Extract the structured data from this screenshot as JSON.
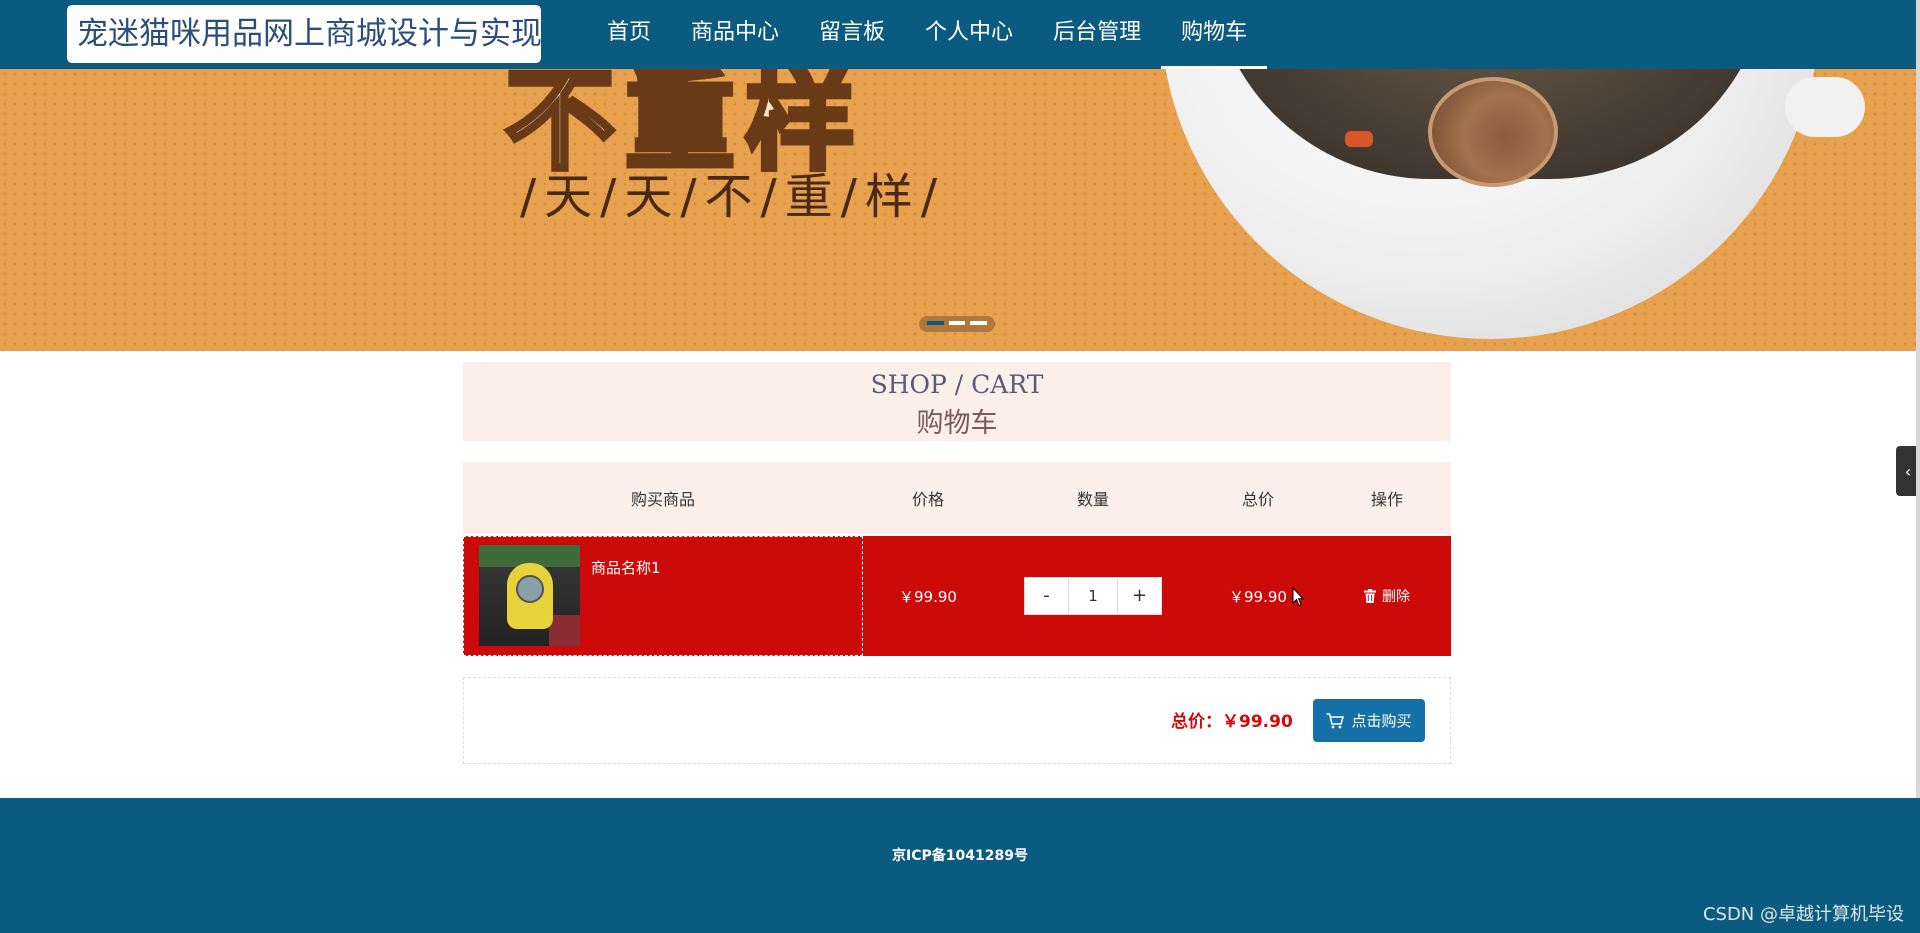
{
  "site": {
    "title": "宠迷猫咪用品网上商城设计与实现"
  },
  "nav": {
    "items": [
      {
        "label": "首页"
      },
      {
        "label": "商品中心"
      },
      {
        "label": "留言板"
      },
      {
        "label": "个人中心"
      },
      {
        "label": "后台管理"
      },
      {
        "label": "购物车",
        "active": true
      }
    ]
  },
  "banner": {
    "headline": "不重样",
    "subtitle": "/天/天/不/重/样/",
    "indicator_count": 3,
    "active_indicator": 1
  },
  "section": {
    "title_en": "SHOP / CART",
    "title_cn": "购物车"
  },
  "cart": {
    "headers": {
      "product": "购买商品",
      "price": "价格",
      "quantity": "数量",
      "total": "总价",
      "action": "操作"
    },
    "items": [
      {
        "name": "商品名称1",
        "price": "￥99.90",
        "quantity": "1",
        "total": "￥99.90",
        "delete_label": "删除"
      }
    ],
    "summary": {
      "total_text": "总价：￥99.90",
      "buy_label": "点击购买"
    },
    "qty_minus": "-",
    "qty_plus": "+"
  },
  "footer": {
    "icp": "京ICP备1041289号",
    "watermark": "CSDN @卓越计算机毕设"
  },
  "side_tab": {
    "icon": "chevron-left-icon",
    "glyph": "‹"
  },
  "colors": {
    "nav_bg": "#0b5a80",
    "row_highlight": "#cc0a0a",
    "buy_button": "#1570a8",
    "total_text": "#d20a0a",
    "section_bg": "#fcefea"
  }
}
